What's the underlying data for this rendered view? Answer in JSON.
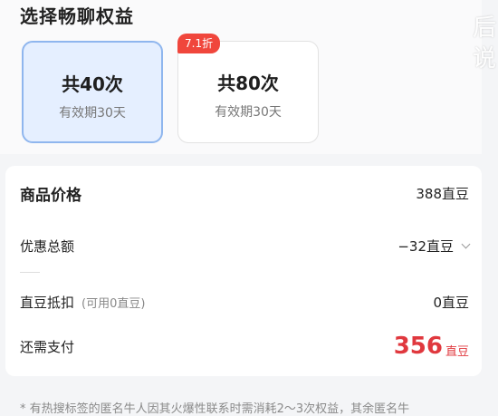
{
  "section": {
    "title": "选择畅聊权益"
  },
  "plans": [
    {
      "title": "共40次",
      "subtitle": "有效期30天",
      "selected": true
    },
    {
      "title": "共80次",
      "subtitle": "有效期30天",
      "selected": false,
      "badge": "7.1折"
    }
  ],
  "pricing": {
    "goods_price_label": "商品价格",
    "goods_price_value": "388直豆",
    "discount_label": "优惠总额",
    "discount_value": "−32直豆",
    "deduct_label": "直豆抵扣",
    "deduct_hint": "(可用0直豆)",
    "deduct_value": "0直豆",
    "pay_label": "还需支付",
    "pay_amount": "356",
    "pay_unit": "直豆"
  },
  "footnote": "* 有热搜标签的匿名牛人因其火爆性联系时需消耗2～3次权益，其余匿名牛",
  "edge_text": "后 说",
  "colors": {
    "accent_red": "#e0383e",
    "selected_border": "#8fb6ee",
    "selected_bg": "#e5efff",
    "badge_bg": "#f0463c"
  }
}
